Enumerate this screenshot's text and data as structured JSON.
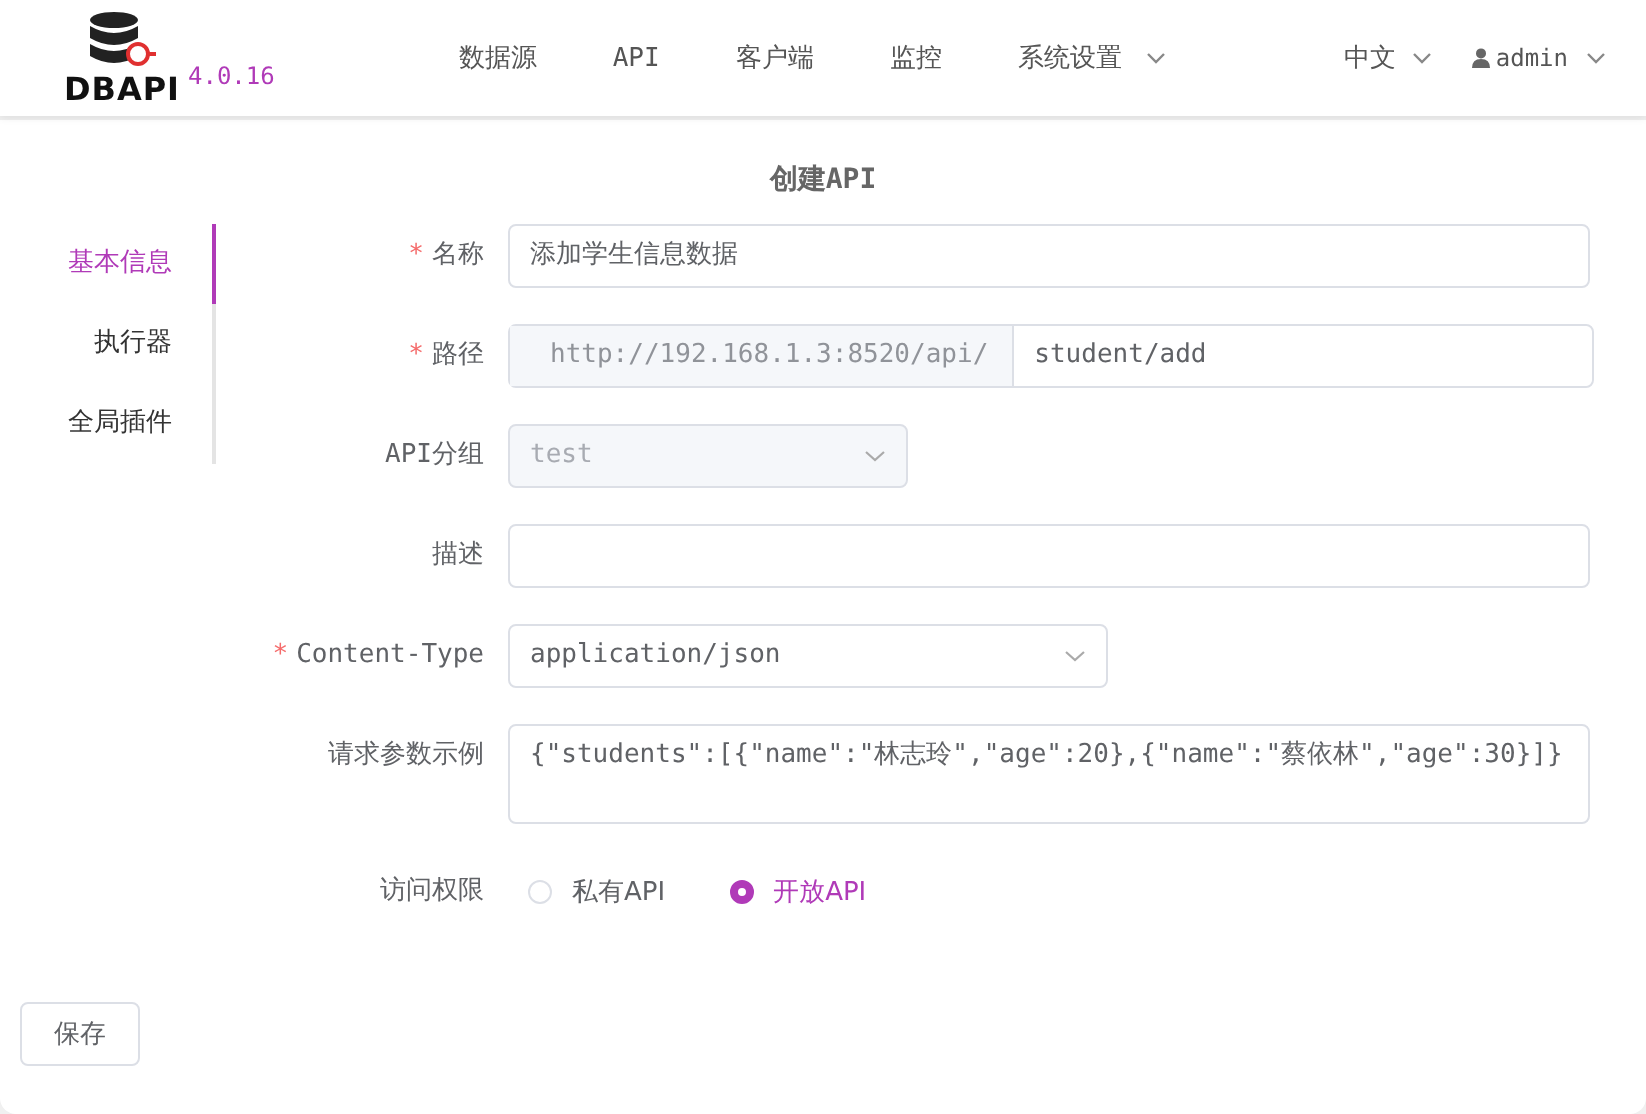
{
  "header": {
    "logo_text": "DBAPI",
    "version": "4.0.16",
    "nav": [
      {
        "label": "数据源",
        "dropdown": false
      },
      {
        "label": "API",
        "dropdown": false
      },
      {
        "label": "客户端",
        "dropdown": false
      },
      {
        "label": "监控",
        "dropdown": false
      },
      {
        "label": "系统设置",
        "dropdown": true
      }
    ],
    "language": "中文",
    "user": "admin"
  },
  "title": "创建API",
  "sidebar": {
    "items": [
      {
        "label": "基本信息",
        "selected": true
      },
      {
        "label": "执行器",
        "selected": false
      },
      {
        "label": "全局插件",
        "selected": false
      }
    ]
  },
  "fields": [
    {
      "kind": "text",
      "label": "名称",
      "required_mark": "*",
      "value": "添加学生信息数据"
    },
    {
      "kind": "prefixed",
      "label": "路径",
      "required_mark": "*",
      "prefix": "http://192.168.1.3:8520/api/",
      "value": "student/add"
    },
    {
      "kind": "select",
      "label": "API分组",
      "value": "test",
      "disabled": true
    },
    {
      "kind": "text",
      "label": "描述"
    },
    {
      "kind": "select",
      "label": "Content-Type",
      "required_mark": "*",
      "value": "application/json",
      "disabled": false
    },
    {
      "kind": "textarea",
      "label": "请求参数示例",
      "value": "{\"students\":[{\"name\":\"林志玲\",\"age\":20},{\"name\":\"蔡依林\",\"age\":30}]}"
    },
    {
      "kind": "radio",
      "label": "访问权限",
      "options": [
        {
          "label": "私有API",
          "selected": false
        },
        {
          "label": "开放API",
          "selected": true
        }
      ]
    }
  ],
  "save_button": "保存"
}
